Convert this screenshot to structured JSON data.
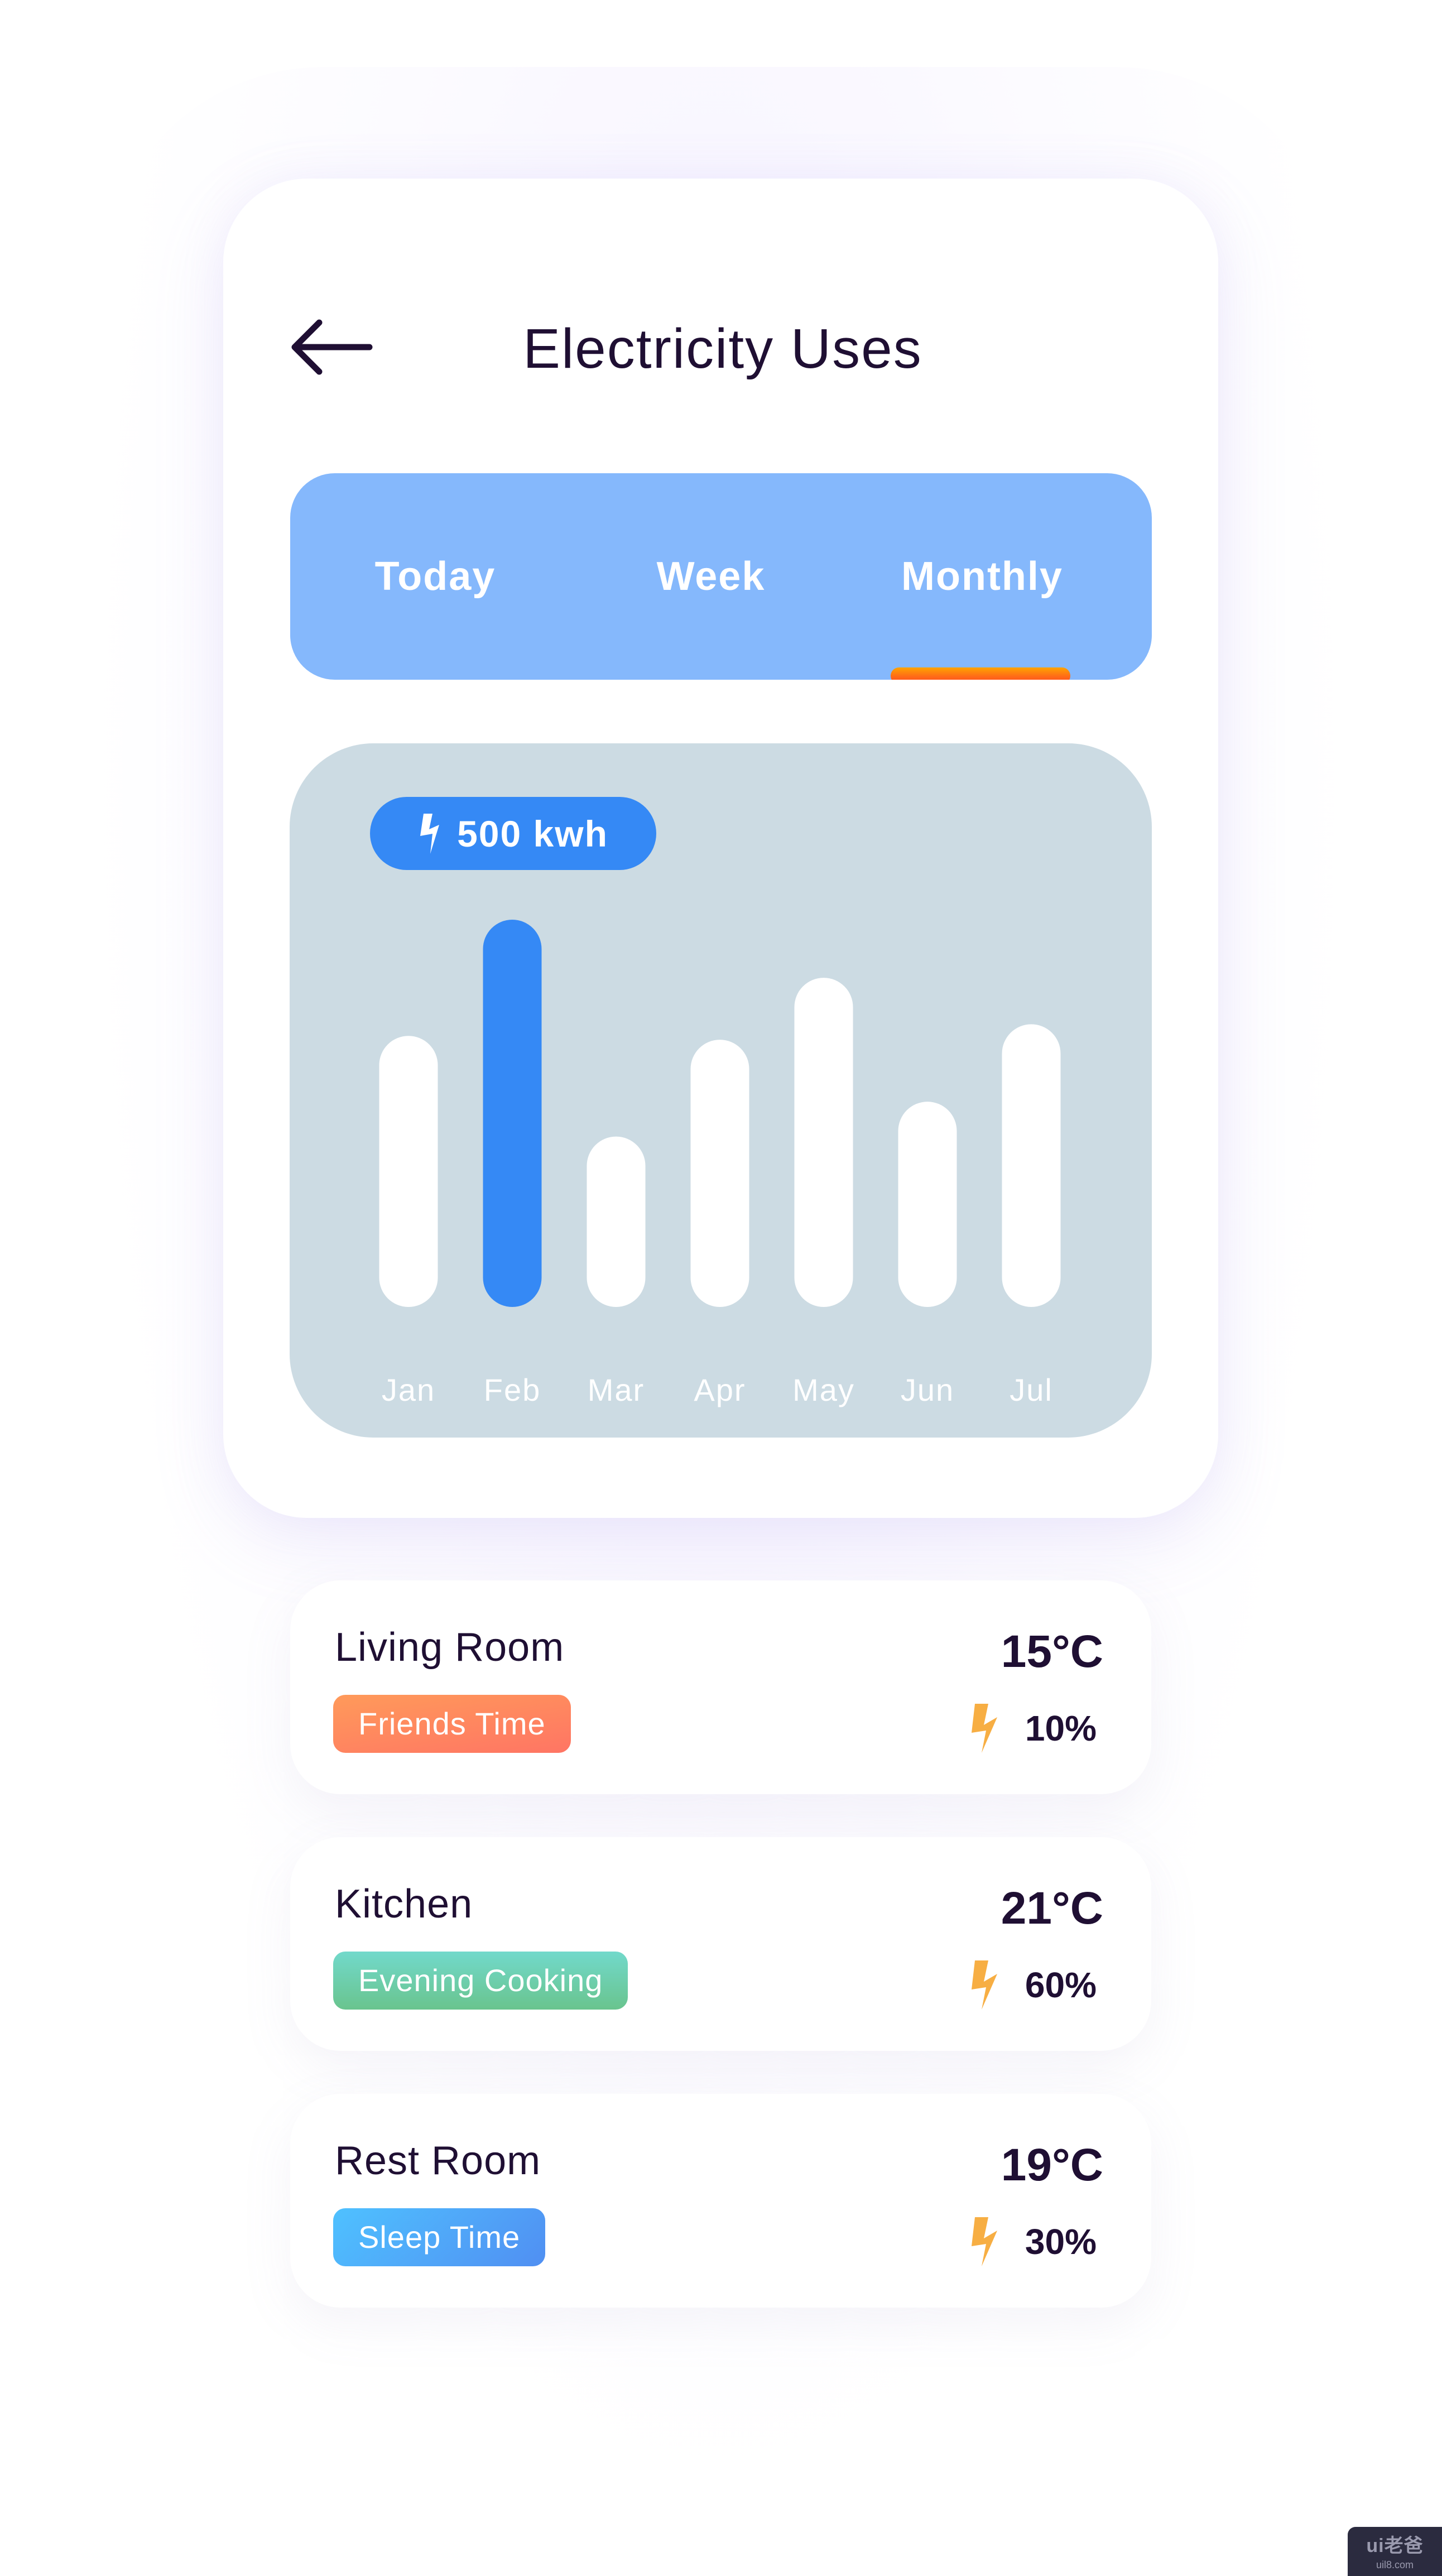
{
  "header": {
    "back_icon": "arrow-left-icon",
    "title": "Electricity Uses"
  },
  "tabs": {
    "items": [
      {
        "label": "Today",
        "active": false
      },
      {
        "label": "Week",
        "active": false
      },
      {
        "label": "Monthly",
        "active": true
      }
    ]
  },
  "usage_badge": {
    "icon": "lightning-bolt-icon",
    "value": "500 kwh"
  },
  "colors": {
    "tabbar_bg": "#85B8FC",
    "active_underline": [
      "#FFA400",
      "#FF4A1F"
    ],
    "chart_panel_bg": "#CCDBE3",
    "highlight_bar": "#3589F5",
    "default_bar": "#FFFFFF",
    "text_dark": "#1F0F33",
    "bolt_orange": "#F7AE43"
  },
  "chart_data": {
    "type": "bar",
    "title": "",
    "xlabel": "",
    "ylabel": "",
    "categories": [
      "Jan",
      "Feb",
      "Mar",
      "Apr",
      "May",
      "Jun",
      "Jul"
    ],
    "values": [
      350,
      500,
      220,
      345,
      425,
      265,
      365
    ],
    "highlighted_index": 1,
    "highlight_label": "500 kwh",
    "unit": "kwh",
    "ylim": [
      0,
      500
    ],
    "grid": false,
    "axis_visible": false
  },
  "rooms": [
    {
      "name": "Living Room",
      "tag": "Friends Time",
      "tag_gradient": [
        "#FF9A5A",
        "#FF7564"
      ],
      "temperature": "15°C",
      "usage_icon": "lightning-bolt-icon",
      "usage": "10%"
    },
    {
      "name": "Kitchen",
      "tag": "Evening Cooking",
      "tag_gradient": [
        "#72D9CB",
        "#69C48E"
      ],
      "temperature": "21°C",
      "usage_icon": "lightning-bolt-icon",
      "usage": "60%"
    },
    {
      "name": "Rest Room",
      "tag": "Sleep Time",
      "tag_gradient": [
        "#4FC1FF",
        "#508FF2"
      ],
      "temperature": "19°C",
      "usage_icon": "lightning-bolt-icon",
      "usage": "30%"
    }
  ],
  "watermark": {
    "logo": "ui老爸",
    "url": "uil8.com"
  }
}
